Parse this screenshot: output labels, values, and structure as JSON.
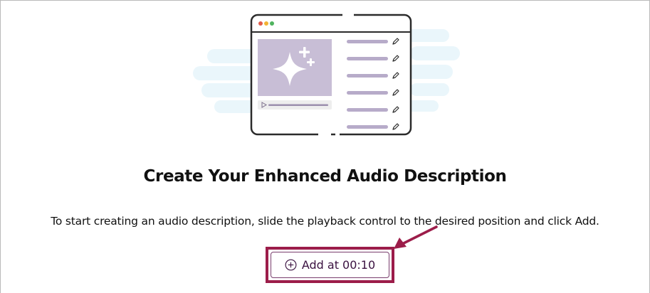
{
  "empty_state": {
    "heading": "Create Your Enhanced Audio Description",
    "instructions": "To start creating an audio description, slide the playback control to the desired position and click Add.",
    "add_button_label": "Add at 00:10"
  },
  "icons": {
    "add": "plus-circle-icon",
    "edit": "pencil-icon",
    "play": "play-icon",
    "sparkle": "sparkle-icon",
    "pointer": "arrow-icon"
  },
  "colors": {
    "highlight": "#9c1d4a",
    "button_text": "#3a1140",
    "illustration_fill": "#c8bed6",
    "illustration_bar": "#b7abc9",
    "background_clouds": "#eaf6fb"
  }
}
